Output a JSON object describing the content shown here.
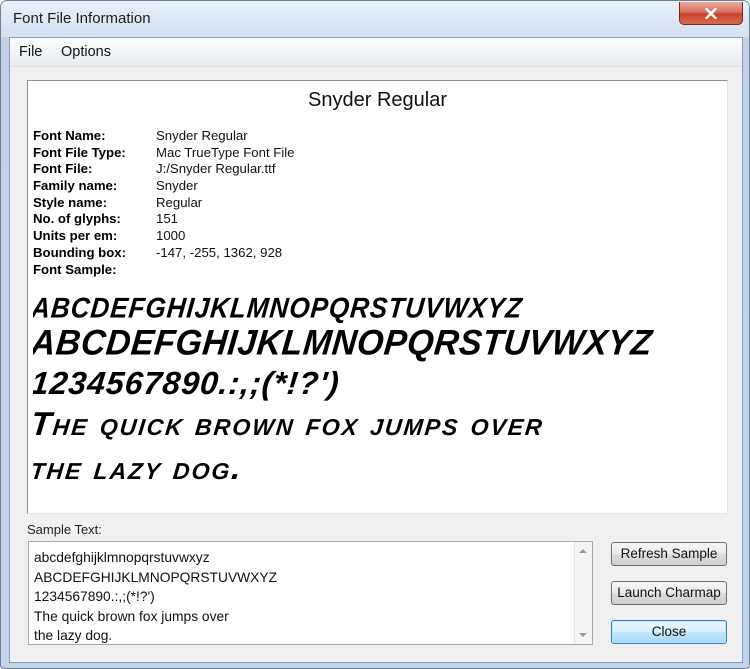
{
  "window": {
    "title": "Font File Information"
  },
  "menu": {
    "file": "File",
    "options": "Options"
  },
  "info": {
    "heading": "Snyder Regular",
    "rows": [
      {
        "label": "Font Name:",
        "value": "Snyder Regular"
      },
      {
        "label": "Font File Type:",
        "value": "Mac TrueType Font File"
      },
      {
        "label": "Font File:",
        "value": "J:/Snyder Regular.ttf"
      },
      {
        "label": "Family name:",
        "value": "Snyder"
      },
      {
        "label": "Style name:",
        "value": "Regular"
      },
      {
        "label": "No. of glyphs:",
        "value": "151"
      },
      {
        "label": "Units per em:",
        "value": "1000"
      },
      {
        "label": "Bounding box:",
        "value": "-147, -255, 1362, 928"
      },
      {
        "label": "Font Sample:",
        "value": ""
      }
    ],
    "sample_lines": [
      "ABCDEFGHIJKLMNOPQRSTUVWXYZ",
      "ABCDEFGHIJKLMNOPQRSTUVWXYZ",
      "1234567890.:,;(*!?')",
      "The quick brown fox jumps over",
      "the lazy dog."
    ]
  },
  "sample_text": {
    "label": "Sample Text:",
    "value": "abcdefghijklmnopqrstuvwxyz\nABCDEFGHIJKLMNOPQRSTUVWXYZ\n1234567890.:,;(*!?')\nThe quick brown fox jumps over\nthe lazy dog."
  },
  "buttons": {
    "refresh": "Refresh Sample",
    "charmap": "Launch Charmap",
    "close": "Close"
  }
}
